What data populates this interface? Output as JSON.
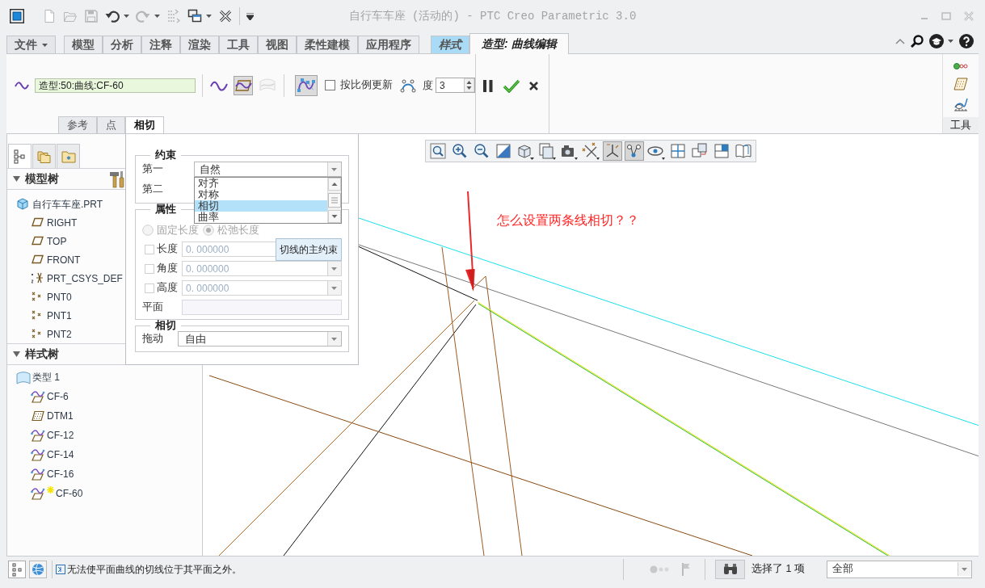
{
  "window": {
    "title": "自行车车座 (活动的) - PTC Creo Parametric 3.0"
  },
  "quick_access": [
    {
      "kind": "new",
      "disabled": true
    },
    {
      "kind": "open",
      "disabled": true
    },
    {
      "kind": "save",
      "disabled": true
    },
    {
      "kind": "undo",
      "disabled": false
    },
    {
      "kind": "redo",
      "disabled": true
    },
    {
      "kind": "regenerate",
      "disabled": true
    },
    {
      "kind": "windows",
      "disabled": false
    },
    {
      "kind": "close",
      "disabled": false
    }
  ],
  "ribbon_tabs": [
    {
      "label": "文件",
      "kind": "menu",
      "selected": false
    },
    {
      "label": "模型",
      "kind": "tab",
      "selected": false
    },
    {
      "label": "分析",
      "kind": "tab",
      "selected": false
    },
    {
      "label": "注释",
      "kind": "tab",
      "selected": false
    },
    {
      "label": "渲染",
      "kind": "tab",
      "selected": false
    },
    {
      "label": "工具",
      "kind": "tab",
      "selected": false
    },
    {
      "label": "视图",
      "kind": "tab",
      "selected": false
    },
    {
      "label": "柔性建模",
      "kind": "tab",
      "selected": false
    },
    {
      "label": "应用程序",
      "kind": "tab",
      "selected": false
    },
    {
      "label": "样式",
      "kind": "context",
      "selected": false
    },
    {
      "label": "造型: 曲线编辑",
      "kind": "context",
      "selected": true
    }
  ],
  "ribbon": {
    "curve_field": {
      "value": "造型:50:曲线:CF-60"
    },
    "curve_modes": [
      {
        "kind": "free",
        "selected": false,
        "disabled": false
      },
      {
        "kind": "planar",
        "selected": true,
        "disabled": false
      },
      {
        "kind": "surface",
        "selected": false,
        "disabled": true
      }
    ],
    "control_points": {
      "selected": true
    },
    "scale_update": {
      "label": "按比例更新",
      "checked": false
    },
    "degree": {
      "label": "度",
      "value": "3"
    },
    "sub_tabs": [
      {
        "label": "参考",
        "selected": false
      },
      {
        "label": "点",
        "selected": false
      },
      {
        "label": "相切",
        "selected": true
      }
    ],
    "tools": {
      "label": "工具"
    }
  },
  "navigator": {
    "tabs": [
      {
        "kind": "tree",
        "selected": true
      },
      {
        "kind": "layers",
        "selected": false
      },
      {
        "kind": "favorites",
        "selected": false
      }
    ],
    "model_tree": {
      "title": "模型树",
      "expanded": true,
      "items": [
        {
          "label": "自行车车座.PRT",
          "kind": "part",
          "children": [
            {
              "label": "RIGHT",
              "kind": "plane"
            },
            {
              "label": "TOP",
              "kind": "plane"
            },
            {
              "label": "FRONT",
              "kind": "plane"
            },
            {
              "label": "PRT_CSYS_DEF",
              "kind": "csys"
            },
            {
              "label": "PNT0",
              "kind": "point"
            },
            {
              "label": "PNT1",
              "kind": "point"
            },
            {
              "label": "PNT2",
              "kind": "point"
            }
          ]
        }
      ]
    },
    "style_tree": {
      "title": "样式树",
      "expanded": true,
      "items": [
        {
          "label": "类型 1",
          "kind": "type",
          "children": [
            {
              "label": "CF-6",
              "kind": "curve",
              "active": false
            },
            {
              "label": "DTM1",
              "kind": "datum",
              "active": false
            },
            {
              "label": "CF-12",
              "kind": "curve",
              "active": false
            },
            {
              "label": "CF-14",
              "kind": "curve",
              "active": false
            },
            {
              "label": "CF-16",
              "kind": "curve",
              "active": false
            },
            {
              "label": "CF-60",
              "kind": "curve",
              "active": true
            }
          ]
        }
      ]
    }
  },
  "tangent_panel": {
    "constraints": {
      "title": "约束",
      "first": {
        "label": "第一",
        "value": "自然"
      },
      "second": {
        "label": "第二"
      },
      "options": [
        {
          "label": "对齐",
          "selected": false
        },
        {
          "label": "对称",
          "selected": false
        },
        {
          "label": "相切",
          "selected": true
        },
        {
          "label": "曲率",
          "selected": false
        }
      ]
    },
    "properties": {
      "title": "属性",
      "length_modes": [
        {
          "label": "固定长度",
          "selected": false,
          "disabled": true
        },
        {
          "label": "松弛长度",
          "selected": true,
          "disabled": true
        }
      ],
      "fields": [
        {
          "label": "长度",
          "checked": false,
          "value": "0. 000000",
          "kind": "plain"
        },
        {
          "label": "角度",
          "checked": false,
          "value": "0. 000000",
          "kind": "dropdown"
        },
        {
          "label": "高度",
          "checked": false,
          "value": "0. 000000",
          "kind": "dropdown"
        }
      ],
      "plane": {
        "label": "平面"
      }
    },
    "tangent": {
      "title": "相切",
      "drag": {
        "label": "拖动",
        "value": "自由"
      }
    },
    "tooltip": "切线的主约束"
  },
  "canvas_toolbar": [
    {
      "kind": "refit",
      "selected": false
    },
    {
      "kind": "zoomin",
      "selected": false
    },
    {
      "kind": "zoomout",
      "selected": false
    },
    {
      "kind": "repaint",
      "selected": false
    },
    {
      "kind": "orientation",
      "selected": false
    },
    {
      "kind": "views",
      "selected": false
    },
    {
      "kind": "display",
      "selected": false
    },
    {
      "kind": "datums",
      "selected": false
    },
    {
      "kind": "csys",
      "selected": true
    },
    {
      "kind": "points",
      "selected": true
    },
    {
      "kind": "spin",
      "selected": false
    },
    {
      "kind": "grid",
      "selected": false
    },
    {
      "kind": "copy",
      "selected": false
    },
    {
      "kind": "pane",
      "selected": false
    },
    {
      "kind": "book",
      "selected": false
    }
  ],
  "annotation": {
    "text": "怎么设置两条线相切？？"
  },
  "status_bar": {
    "message": "无法使平面曲线的切线位于其平面之外。",
    "selection": "选择了 1 项",
    "filter": "全部"
  }
}
